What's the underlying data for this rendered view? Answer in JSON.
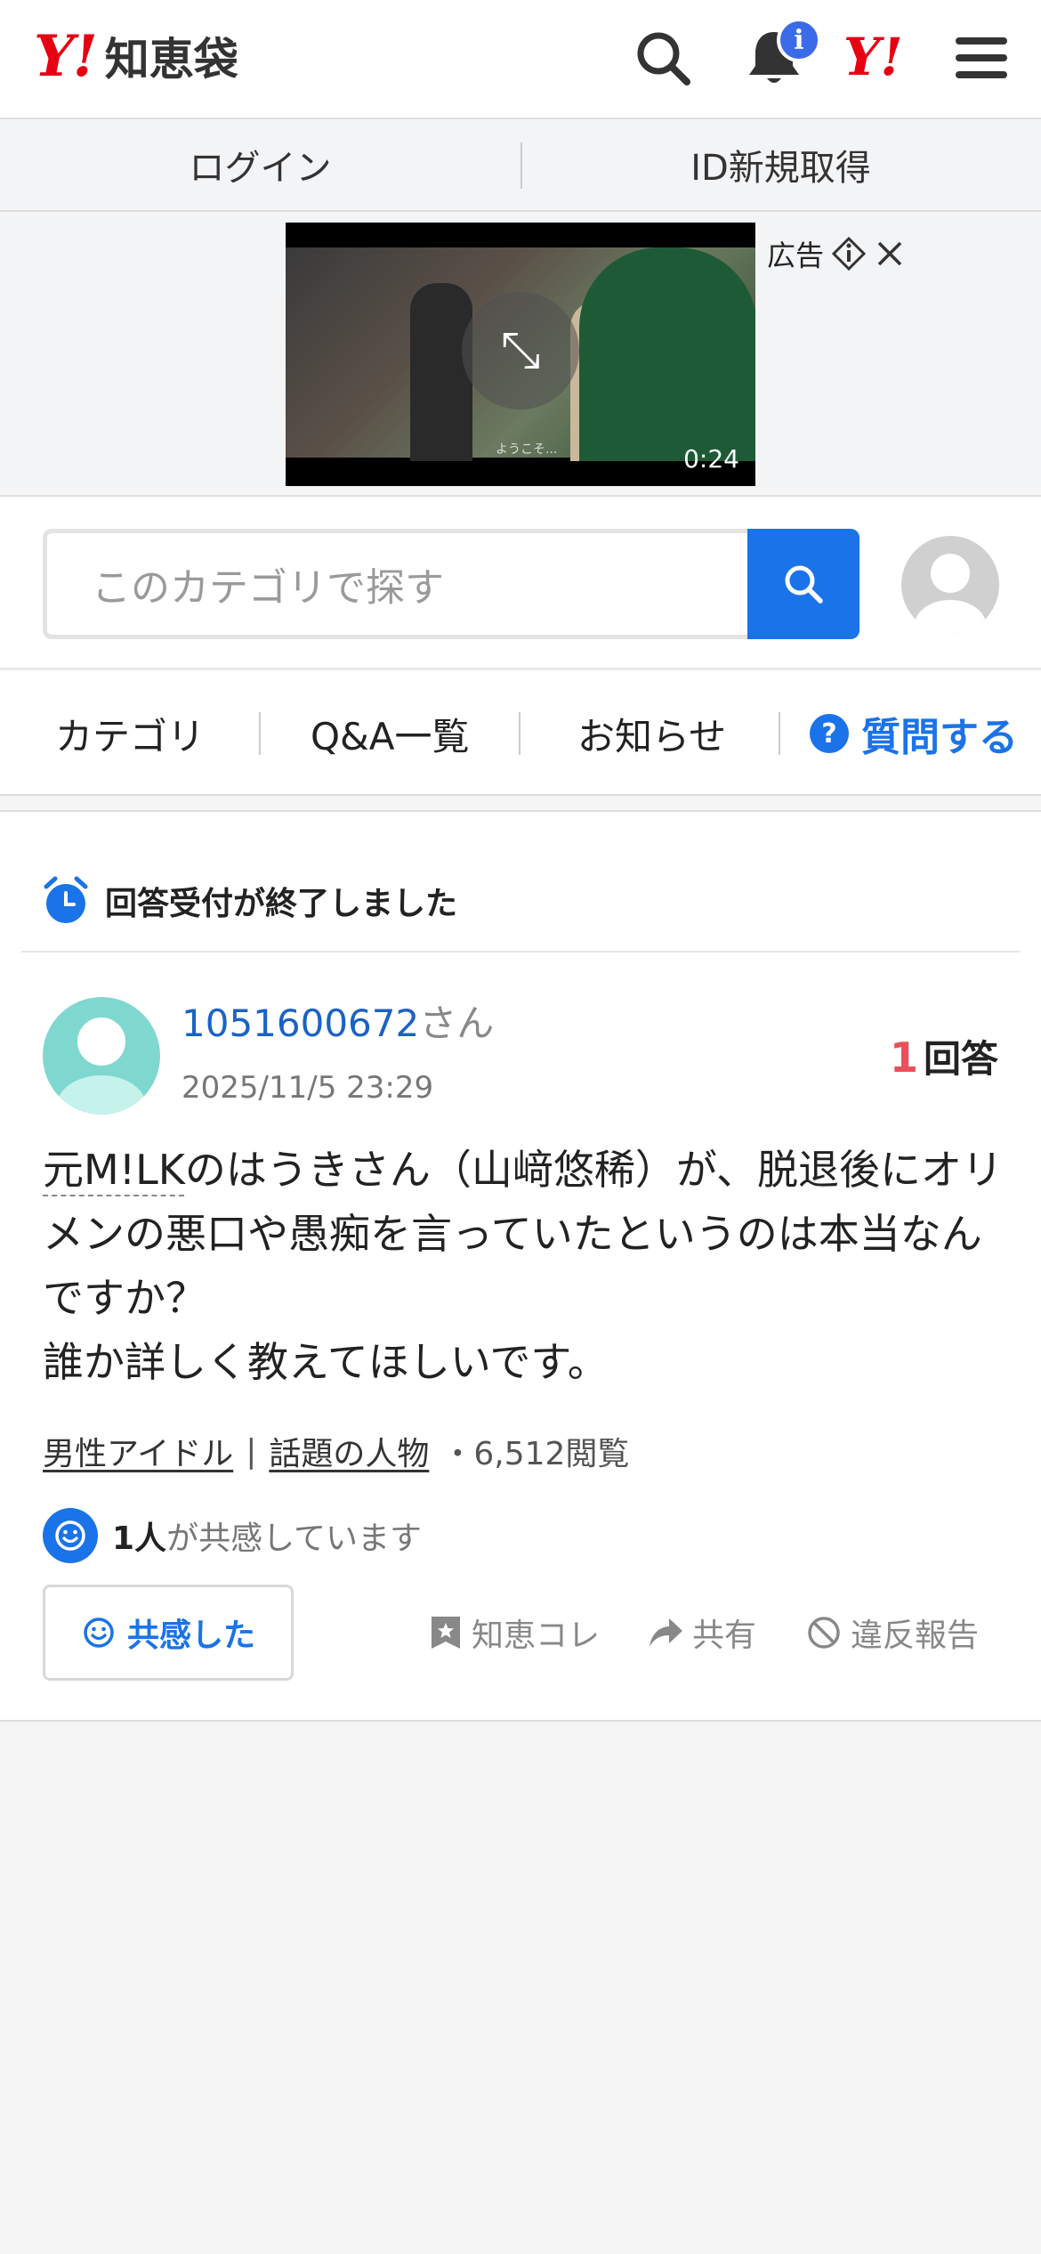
{
  "header": {
    "logo_y": "Y!",
    "logo_text": "知恵袋",
    "notification_badge": "i",
    "yahoo_mini": "Y!"
  },
  "loginbar": {
    "login": "ログイン",
    "register": "ID新規取得"
  },
  "ad": {
    "label": "広告",
    "duration": "0:24",
    "caption": "ようこそ..."
  },
  "search": {
    "placeholder": "このカテゴリで探す"
  },
  "nav": {
    "category": "カテゴリ",
    "qa_list": "Q&A一覧",
    "news": "お知らせ",
    "ask": "質問する",
    "ask_icon": "?"
  },
  "question": {
    "status": "回答受付が終了しました",
    "user_id": "1051600672",
    "user_suffix": "さん",
    "date": "2025/11/5 23:29",
    "answer_count": "1",
    "answer_label": "回答",
    "text_link": "元M!LK",
    "text_rest": "のはうきさん（山﨑悠稀）が、脱退後にオリメンの悪口や愚痴を言っていたというのは本当なんですか？",
    "text_line2": "誰か詳しく教えてほしいです。",
    "tag1": "男性アイドル",
    "tag_sep": "|",
    "tag2": "話題の人物",
    "views": "・6,512閲覧",
    "empathy_count": "1人",
    "empathy_text": "が共感しています",
    "empathy_button": "共感した",
    "bookmark": "知恵コレ",
    "share": "共有",
    "report": "違反報告"
  },
  "colors": {
    "brand_red": "#e60012",
    "link_blue": "#1a73e8",
    "answer_red": "#e8505b"
  }
}
